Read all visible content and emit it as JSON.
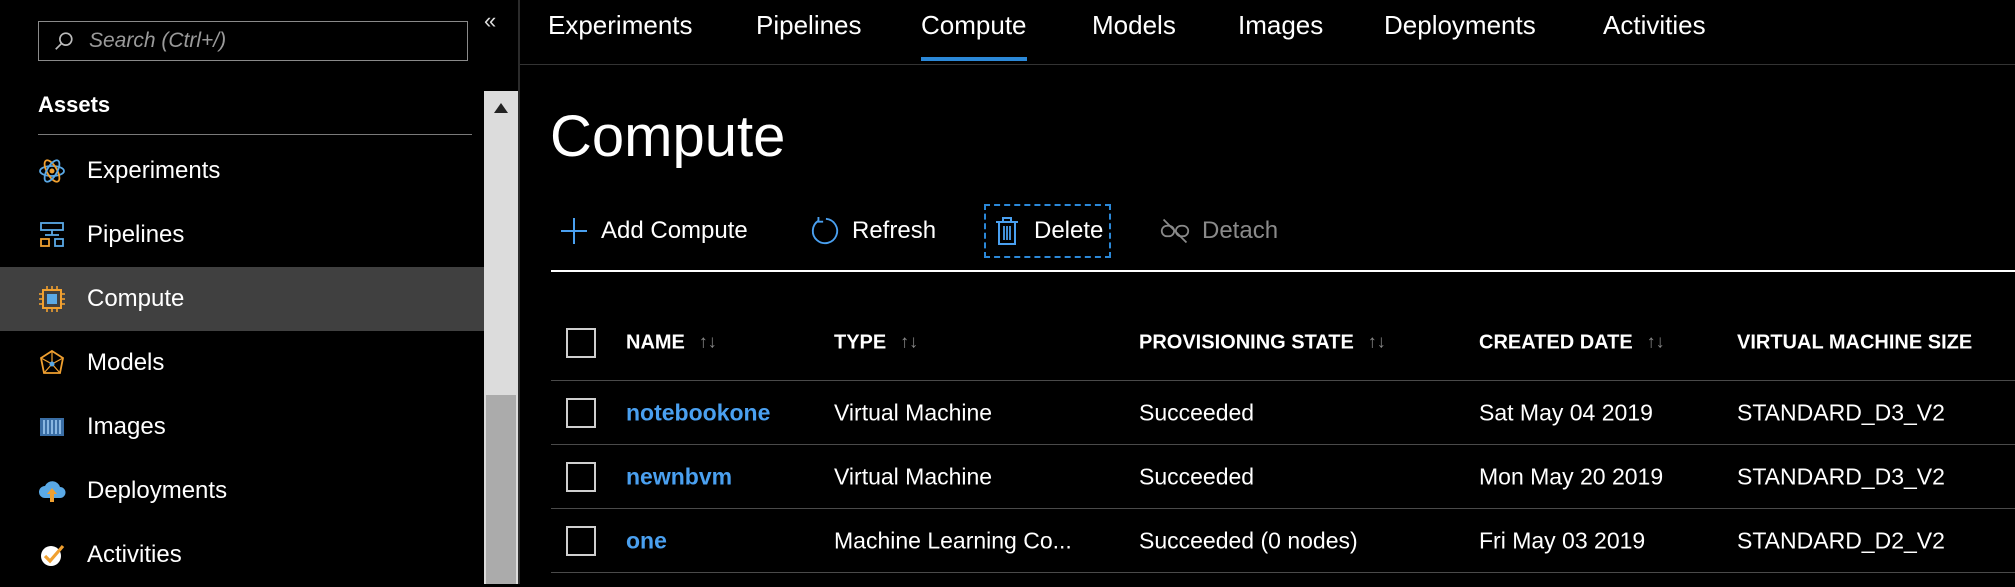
{
  "sidebar": {
    "search_placeholder": "Search (Ctrl+/)",
    "collapse_glyph": "«",
    "section_heading": "Assets",
    "items": [
      {
        "label": "Experiments",
        "icon": "atom-icon",
        "active": false
      },
      {
        "label": "Pipelines",
        "icon": "pipeline-icon",
        "active": false
      },
      {
        "label": "Compute",
        "icon": "chip-icon",
        "active": true
      },
      {
        "label": "Models",
        "icon": "model-icon",
        "active": false
      },
      {
        "label": "Images",
        "icon": "container-icon",
        "active": false
      },
      {
        "label": "Deployments",
        "icon": "cloud-upload-icon",
        "active": false
      },
      {
        "label": "Activities",
        "icon": "check-badge-icon",
        "active": false
      }
    ]
  },
  "tabs": [
    {
      "label": "Experiments",
      "active": false
    },
    {
      "label": "Pipelines",
      "active": false
    },
    {
      "label": "Compute",
      "active": true
    },
    {
      "label": "Models",
      "active": false
    },
    {
      "label": "Images",
      "active": false
    },
    {
      "label": "Deployments",
      "active": false
    },
    {
      "label": "Activities",
      "active": false
    }
  ],
  "page_title": "Compute",
  "toolbar": {
    "add_label": "Add Compute",
    "refresh_label": "Refresh",
    "delete_label": "Delete",
    "detach_label": "Detach"
  },
  "table": {
    "columns": [
      "NAME",
      "TYPE",
      "PROVISIONING STATE",
      "CREATED DATE",
      "VIRTUAL MACHINE SIZE"
    ],
    "rows": [
      {
        "name": "notebookone",
        "type": "Virtual Machine",
        "state": "Succeeded",
        "date": "Sat May 04 2019",
        "size": "STANDARD_D3_V2"
      },
      {
        "name": "newnbvm",
        "type": "Virtual Machine",
        "state": "Succeeded",
        "date": "Mon May 20 2019",
        "size": "STANDARD_D3_V2"
      },
      {
        "name": "one",
        "type": "Machine Learning Co...",
        "state": "Succeeded (0 nodes)",
        "date": "Fri May 03 2019",
        "size": "STANDARD_D2_V2"
      }
    ]
  },
  "colors": {
    "accent": "#2b88d8",
    "link": "#4aa0f0",
    "active_nav_bg": "#404040",
    "icon_orange": "#f0a030",
    "icon_blue": "#5aa9e6"
  }
}
